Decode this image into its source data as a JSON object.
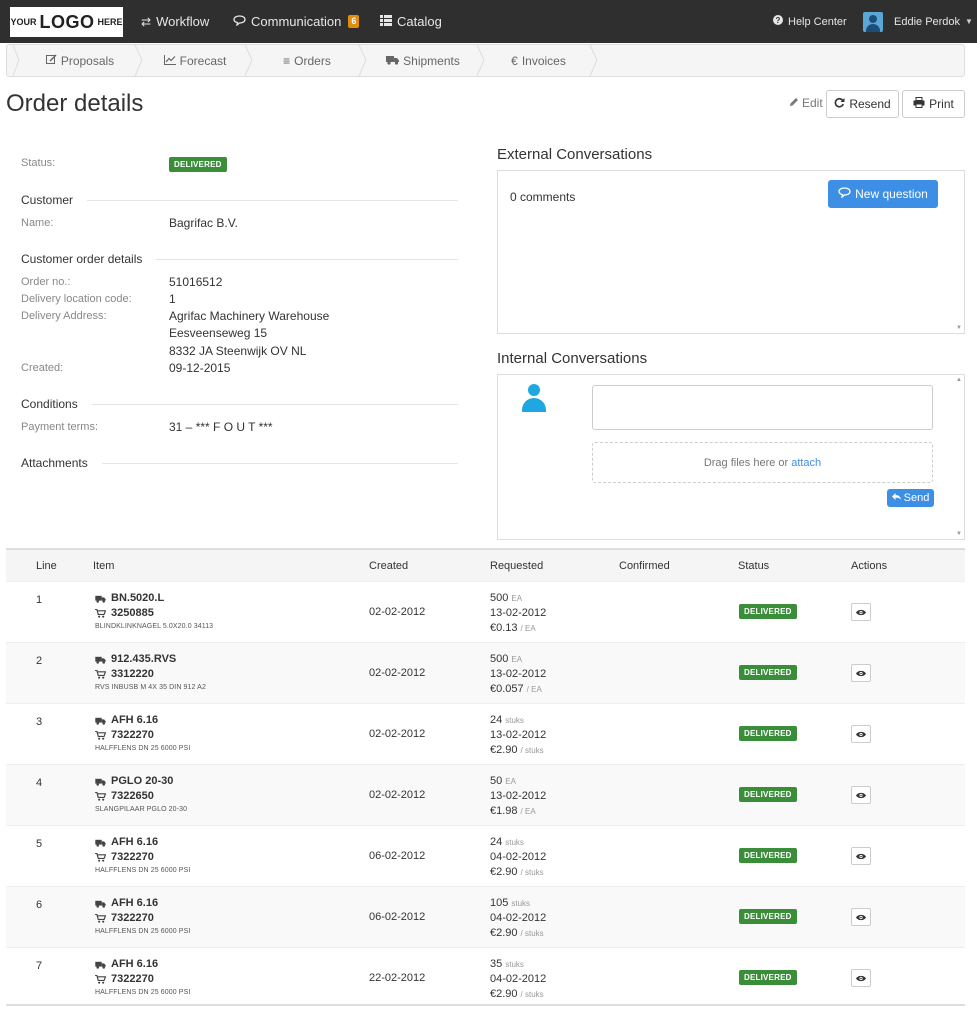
{
  "navbar": {
    "logo_small_1": "YOUR",
    "logo_big": "LOGO",
    "logo_small_2": "HERE",
    "workflow": "Workflow",
    "communication": "Communication",
    "communication_count": "6",
    "catalog": "Catalog",
    "help": "Help Center",
    "user": "Eddie Perdok"
  },
  "steps": [
    "Proposals",
    "Forecast",
    "Orders",
    "Shipments",
    "Invoices"
  ],
  "page": {
    "title": "Order details",
    "edit": "Edit",
    "resend": "Resend",
    "print": "Print"
  },
  "details": {
    "status_label": "Status:",
    "status_value": "DELIVERED",
    "customer_heading": "Customer",
    "name_label": "Name:",
    "name_value": "Bagrifac B.V.",
    "order_heading": "Customer order details",
    "order_no_label": "Order no.:",
    "order_no_value": "51016512",
    "loc_code_label": "Delivery location code:",
    "loc_code_value": "1",
    "address_label": "Delivery Address:",
    "address_line1": "Agrifac Machinery Warehouse",
    "address_line2": "Eesveenseweg 15",
    "address_line3": "8332 JA Steenwijk OV NL",
    "created_label": "Created:",
    "created_value": "09-12-2015",
    "conditions_heading": "Conditions",
    "payment_label": "Payment terms:",
    "payment_value": "31 – *** F O U T ***",
    "attachments_heading": "Attachments"
  },
  "external": {
    "title": "External Conversations",
    "comments": "0 comments",
    "new_question": "New question"
  },
  "internal": {
    "title": "Internal Conversations",
    "drop_text": "Drag files here or",
    "attach": "attach",
    "send": "Send"
  },
  "table": {
    "headers": {
      "line": "Line",
      "item": "Item",
      "created": "Created",
      "requested": "Requested",
      "confirmed": "Confirmed",
      "status": "Status",
      "actions": "Actions"
    },
    "rows": [
      {
        "line": "1",
        "code": "BN.5020.L",
        "article": "3250885",
        "desc": "BLINDKLINKNAGEL 5.0X20.0 34113",
        "created": "02-02-2012",
        "qty": "500",
        "qty_unit": "EA",
        "req_date": "13-02-2012",
        "price": "€0.13",
        "price_unit": "/ EA",
        "status": "DELIVERED"
      },
      {
        "line": "2",
        "code": "912.435.RVS",
        "article": "3312220",
        "desc": "RVS INBUSB M 4X 35 DIN 912 A2",
        "created": "02-02-2012",
        "qty": "500",
        "qty_unit": "EA",
        "req_date": "13-02-2012",
        "price": "€0.057",
        "price_unit": "/ EA",
        "status": "DELIVERED"
      },
      {
        "line": "3",
        "code": "AFH 6.16",
        "article": "7322270",
        "desc": "HALFFLENS DN 25 6000 PSI",
        "created": "02-02-2012",
        "qty": "24",
        "qty_unit": "stuks",
        "req_date": "13-02-2012",
        "price": "€2.90",
        "price_unit": "/ stuks",
        "status": "DELIVERED"
      },
      {
        "line": "4",
        "code": "PGLO 20-30",
        "article": "7322650",
        "desc": "SLANGPILAAR PGLO 20-30",
        "created": "02-02-2012",
        "qty": "50",
        "qty_unit": "EA",
        "req_date": "13-02-2012",
        "price": "€1.98",
        "price_unit": "/ EA",
        "status": "DELIVERED"
      },
      {
        "line": "5",
        "code": "AFH 6.16",
        "article": "7322270",
        "desc": "HALFFLENS DN 25 6000 PSI",
        "created": "06-02-2012",
        "qty": "24",
        "qty_unit": "stuks",
        "req_date": "04-02-2012",
        "price": "€2.90",
        "price_unit": "/ stuks",
        "status": "DELIVERED"
      },
      {
        "line": "6",
        "code": "AFH 6.16",
        "article": "7322270",
        "desc": "HALFFLENS DN 25 6000 PSI",
        "created": "06-02-2012",
        "qty": "105",
        "qty_unit": "stuks",
        "req_date": "04-02-2012",
        "price": "€2.90",
        "price_unit": "/ stuks",
        "status": "DELIVERED"
      },
      {
        "line": "7",
        "code": "AFH 6.16",
        "article": "7322270",
        "desc": "HALFFLENS DN 25 6000 PSI",
        "created": "22-02-2012",
        "qty": "35",
        "qty_unit": "stuks",
        "req_date": "04-02-2012",
        "price": "€2.90",
        "price_unit": "/ stuks",
        "status": "DELIVERED"
      }
    ]
  },
  "colors": {
    "navbar": "#2f2f2f",
    "accent": "#3d8fe6",
    "delivered": "#3a8e3a",
    "badge": "#e08e0b"
  }
}
